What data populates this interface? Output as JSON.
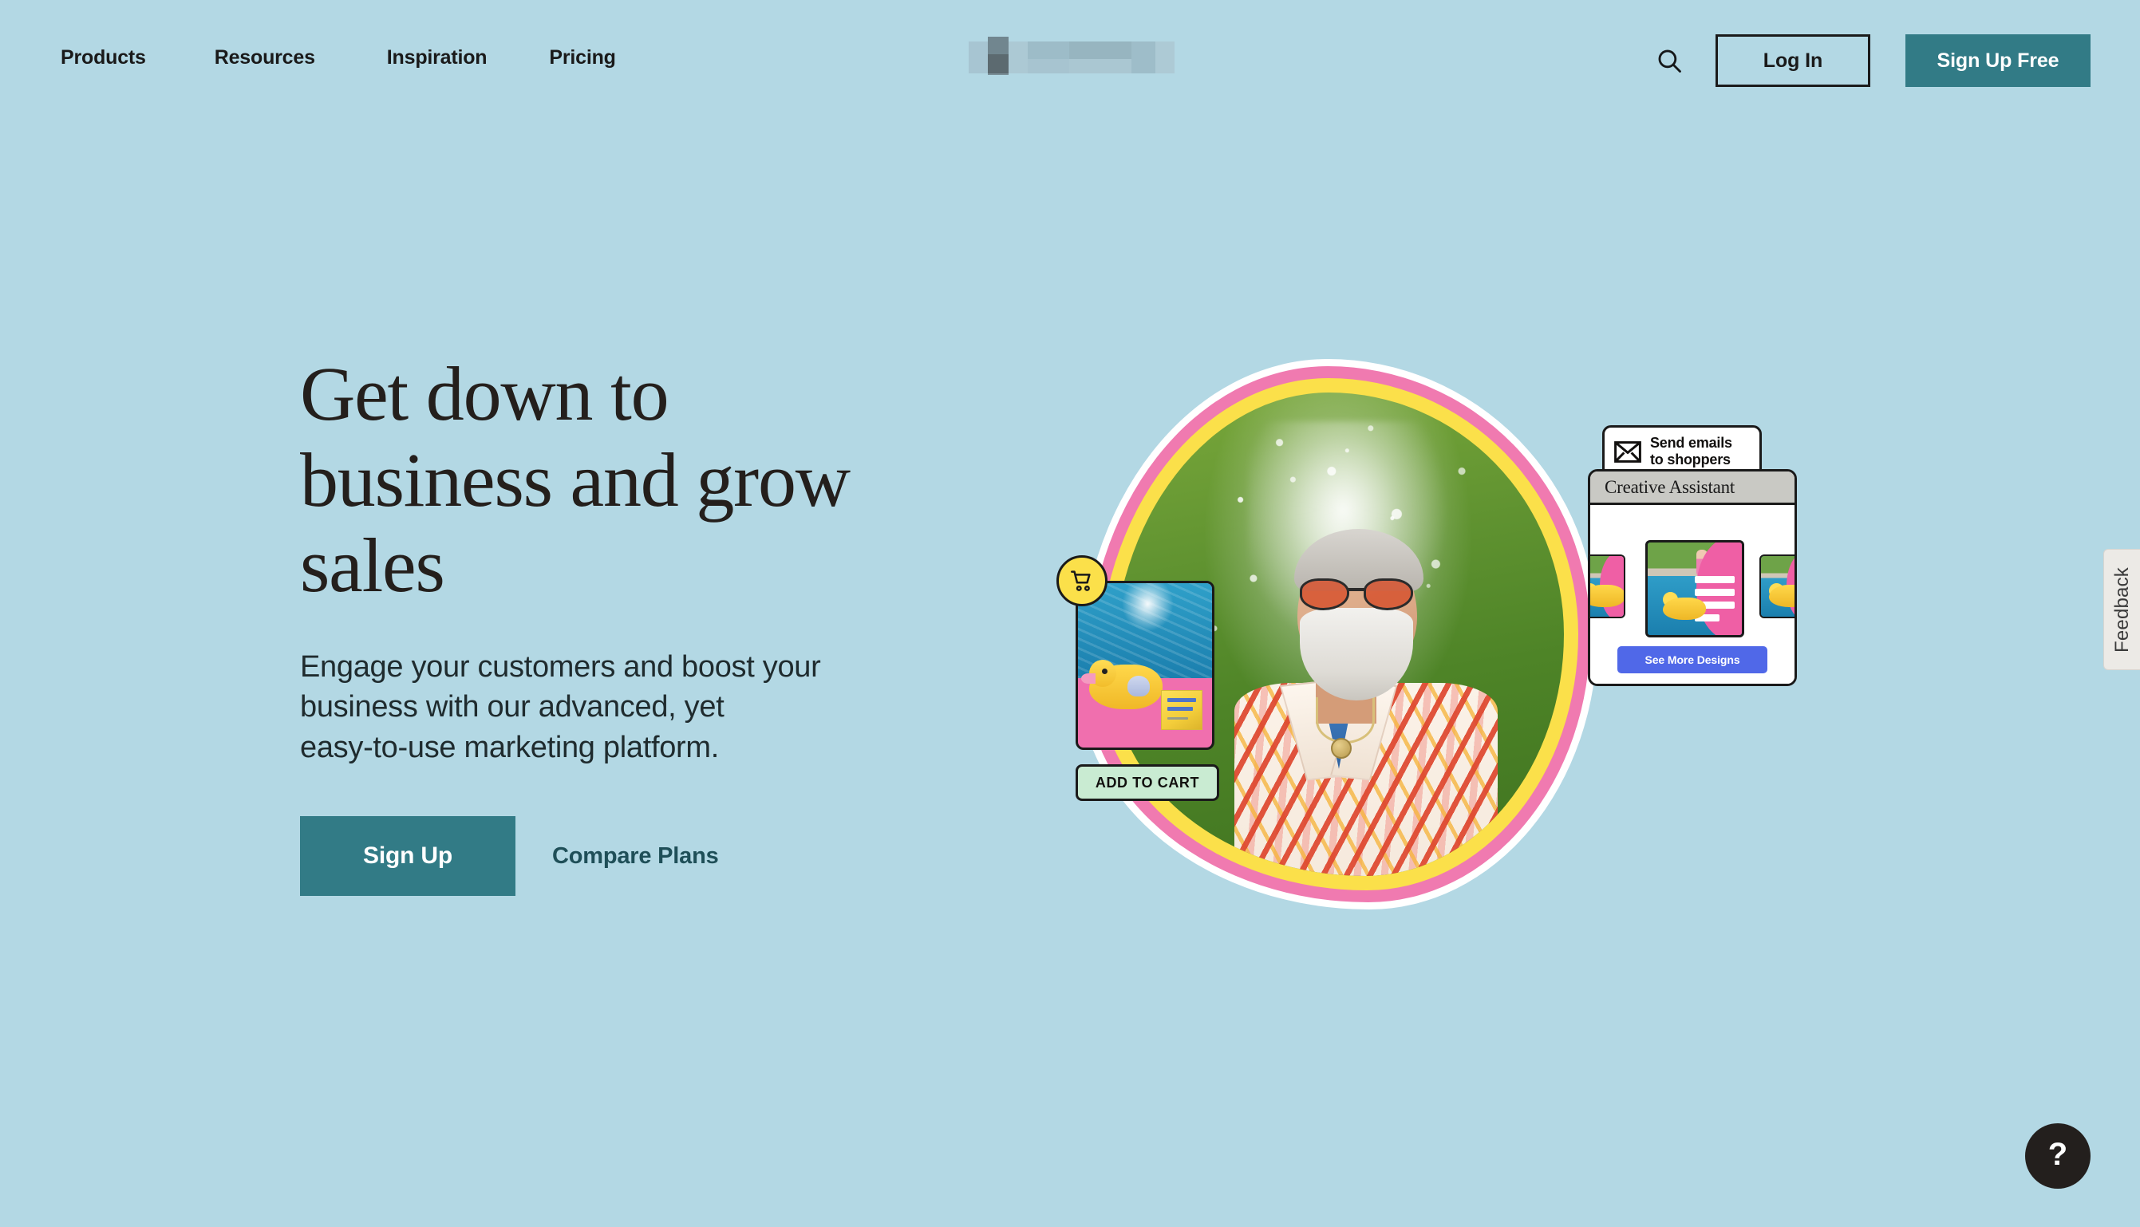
{
  "theme": {
    "background": "#b3d8e4",
    "accent_teal": "#327b86",
    "ink": "#1a1a1a",
    "blob_pink": "#f07ab0",
    "blob_yellow": "#fbe04a",
    "link_teal": "#1f4f58",
    "addcart_green": "#c9ebd2",
    "designs_blue": "#5068e8"
  },
  "header": {
    "nav": [
      {
        "label": "Products"
      },
      {
        "label": "Resources"
      },
      {
        "label": "Inspiration"
      },
      {
        "label": "Pricing"
      }
    ],
    "logo_alt": "",
    "search_icon": "search-icon",
    "login_label": "Log In",
    "signup_label": "Sign Up Free"
  },
  "hero": {
    "title": "Get down to business and grow sales",
    "title_lines": [
      "Get down to",
      "business and grow",
      "sales"
    ],
    "subtitle": "Engage your customers and boost your business with our advanced, yet easy-to-use marketing platform.",
    "subtitle_lines": [
      "Engage your customers and boost your",
      "business with our advanced, yet",
      "easy-to-use marketing platform."
    ],
    "primary_cta": "Sign Up",
    "secondary_cta": "Compare Plans"
  },
  "art": {
    "cart_icon": "shopping-cart-icon",
    "add_to_cart_label": "ADD TO CART",
    "email_card": {
      "icon": "envelope-icon",
      "line1": "Send emails",
      "line2": "to shoppers"
    },
    "creative_assistant": {
      "title": "Creative Assistant",
      "button_label": "See More Designs"
    }
  },
  "feedback": {
    "label": "Feedback"
  },
  "help": {
    "label": "?"
  }
}
